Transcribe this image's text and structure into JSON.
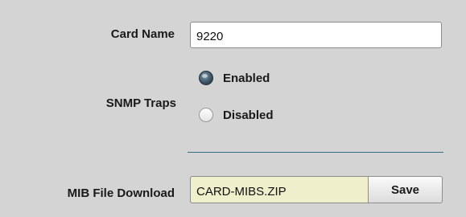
{
  "card_name": {
    "label": "Card Name",
    "value": "9220"
  },
  "snmp_traps": {
    "label": "SNMP Traps",
    "options": [
      {
        "label": "Enabled",
        "selected": true
      },
      {
        "label": "Disabled",
        "selected": false
      }
    ]
  },
  "mib_download": {
    "label": "MIB File Download",
    "file_name": "CARD-MIBS.ZIP",
    "save_label": "Save"
  },
  "colors": {
    "panel_background": "#d4d4d4",
    "divider": "#3a6f8a",
    "file_field_background": "#efefcb",
    "input_background": "#ffffff"
  }
}
